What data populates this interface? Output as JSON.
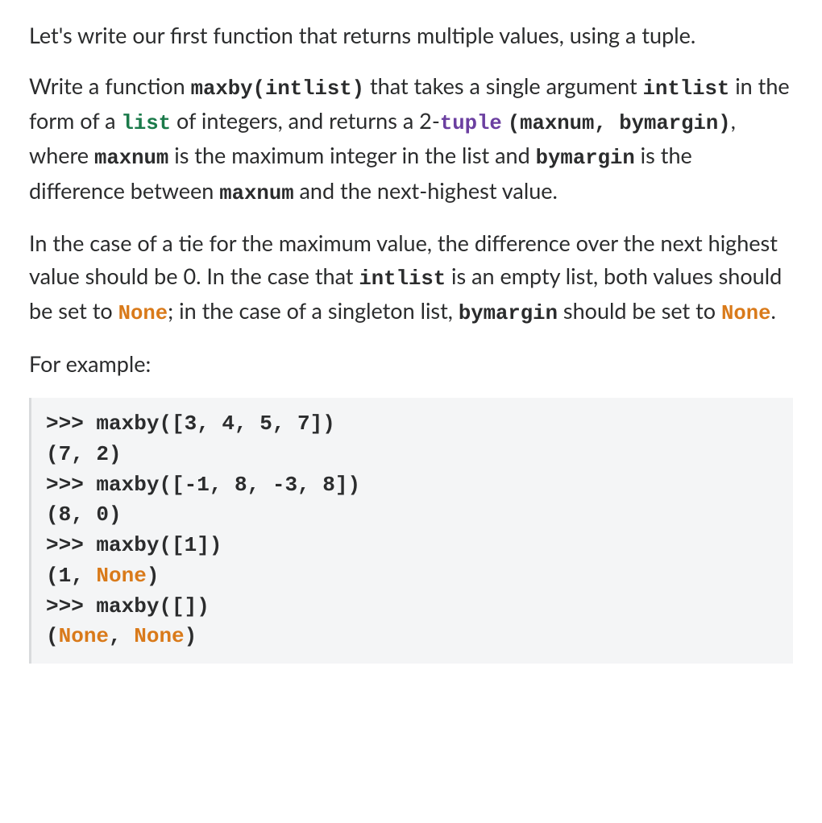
{
  "p1": {
    "t1": "Let's write our first function that returns multiple values, using a tuple."
  },
  "p2": {
    "t1": "Write a function ",
    "c1": "maxby(intlist)",
    "t2": " that takes a single argument ",
    "c2": "intlist",
    "t3": " in the form of a ",
    "kw_list": "list",
    "t4": " of integers, and returns a 2-",
    "kw_tuple": "tuple",
    "t5_code": "(maxnum, bymargin)",
    "t6": ", where ",
    "c3": "maxnum",
    "t7": " is the maximum integer in the list and ",
    "c4": "bymargin",
    "t8": " is the difference between ",
    "c5": "maxnum",
    "t9": " and the next-highest value."
  },
  "p3": {
    "t1": "In the case of a tie for the maximum value, the difference over the next highest value should be 0. In the case that ",
    "c1": "intlist",
    "t2": " is an empty list, both values should be set to ",
    "kw_none1": "None",
    "t3": "; in the case of a singleton list, ",
    "c2": "bymargin",
    "t4": " should be set to ",
    "kw_none2": "None",
    "t5": "."
  },
  "p4": {
    "t1": "For example:"
  },
  "codeblock": {
    "l1a": ">>> maxby([3, 4, 5, 7])",
    "l2a": "(7, 2)",
    "l3a": ">>> maxby([-1, 8, -3, 8])",
    "l4a": "(8, 0)",
    "l5a": ">>> maxby([1])",
    "l6a": "(1, ",
    "l6b": "None",
    "l6c": ")",
    "l7a": ">>> maxby([])",
    "l8a": "(",
    "l8b": "None",
    "l8c": ", ",
    "l8d": "None",
    "l8e": ")"
  }
}
